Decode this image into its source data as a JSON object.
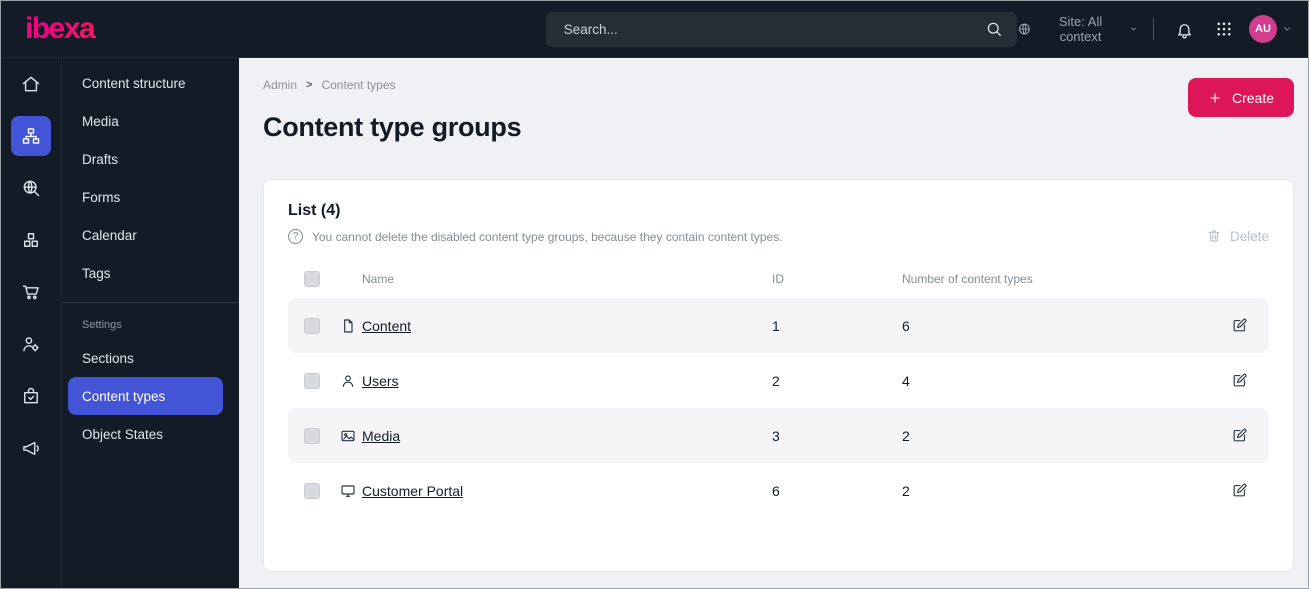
{
  "colors": {
    "dark": "#131c26",
    "accent-blue": "#4355d6",
    "primary-pink": "#dc1657",
    "stripe": "#f5f5f7",
    "main-bg": "#f0f1f4",
    "logo-from": "#f0047f",
    "logo-to": "#ff4713",
    "avatar-bg": "#cf3d8c"
  },
  "topbar": {
    "logo": "ibexa",
    "search": {
      "placeholder": "Search..."
    },
    "site_context": {
      "label": "Site: All context"
    },
    "avatar": {
      "initials": "AU"
    }
  },
  "rail": {
    "icons": [
      "home-icon",
      "content-tree-icon",
      "search-globe-icon",
      "product-boxes-icon",
      "commerce-cart-icon",
      "admin-user-settings-icon",
      "order-check-icon",
      "megaphone-icon"
    ],
    "active_index": 1
  },
  "sidebar": {
    "items": [
      {
        "label": "Content structure"
      },
      {
        "label": "Media"
      },
      {
        "label": "Drafts"
      },
      {
        "label": "Forms"
      },
      {
        "label": "Calendar"
      },
      {
        "label": "Tags"
      }
    ],
    "settings_heading": "Settings",
    "settings_items": [
      {
        "label": "Sections"
      },
      {
        "label": "Content types",
        "active": true
      },
      {
        "label": "Object States"
      }
    ]
  },
  "breadcrumb": {
    "items": [
      "Admin",
      "Content types"
    ],
    "separator": ">"
  },
  "page": {
    "title": "Content type groups",
    "create_label": "Create"
  },
  "list": {
    "title": "List (4)",
    "help_text": "You cannot delete the disabled content type groups, because they contain content types.",
    "delete_label": "Delete",
    "columns": {
      "name": "Name",
      "id": "ID",
      "count": "Number of content types"
    },
    "rows": [
      {
        "icon": "content-file-icon",
        "name": "Content",
        "id": "1",
        "count": "6"
      },
      {
        "icon": "user-icon",
        "name": "Users",
        "id": "2",
        "count": "4"
      },
      {
        "icon": "image-icon",
        "name": "Media",
        "id": "3",
        "count": "2"
      },
      {
        "icon": "monitor-icon",
        "name": "Customer Portal",
        "id": "6",
        "count": "2"
      }
    ]
  }
}
